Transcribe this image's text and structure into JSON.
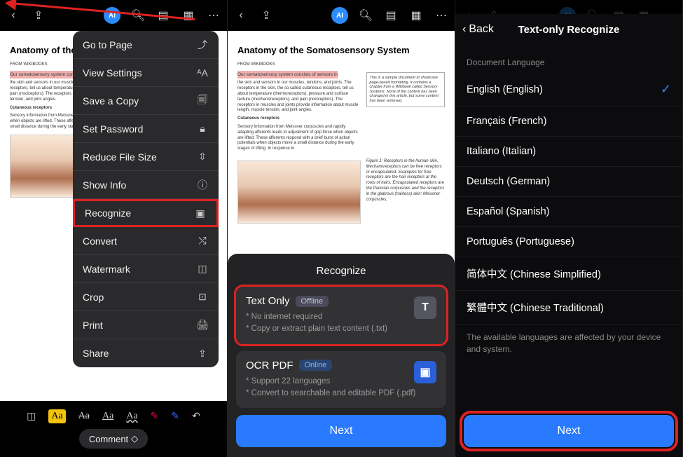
{
  "doc": {
    "title": "Anatomy of the Somatosensory System",
    "sub": "From Wikibooks",
    "hl": "Our somatosensory system consists of sensors in",
    "txt1": "the skin and sensors in our muscles, tendons, and joints. The receptors in the skin, the so called cutaneous receptors, tell us about temperature (thermoreceptors), pressure and surface texture (mechanoreceptors), and pain (nociceptors). The receptors in muscles and joints provide information about muscle length, muscle tension, and joint angles.",
    "section": "Cutaneous receptors",
    "txt2": "Sensory information from Meissner corpuscles and rapidly adapting afferents leads to adjustment of grip force when objects are lifted. These afferents respond with a brief burst of action potentials when objects move a small distance during the early stages of lifting. In response to",
    "box": "This is a sample document to showcase page-based formatting. It contains a chapter from a Wikibook called Sensory Systems. None of the content has been changed in this article, but some content has been removed.",
    "figcap": "Figure 1: Receptors in the human skin. Mechanoreceptors can be free receptors or encapsulated. Examples for free receptors are the hair receptors at the roots of hairs. Encapsulated receptors are the Pacinian corpuscles and the receptors in the glabrous (hairless) skin: Meissner corpuscles,"
  },
  "topbar_ai": "AI",
  "screen1": {
    "menu": {
      "goto": "Go to Page",
      "view": "View Settings",
      "savecopy": "Save a Copy",
      "setpwd": "Set Password",
      "reduce": "Reduce File Size",
      "showinfo": "Show Info",
      "recognize": "Recognize",
      "convert": "Convert",
      "watermark": "Watermark",
      "crop": "Crop",
      "print": "Print",
      "share": "Share"
    },
    "comment": "Comment"
  },
  "screen2": {
    "sheet_title": "Recognize",
    "opt1": {
      "title": "Text Only",
      "badge": "Offline",
      "l1": "* No internet required",
      "l2": "* Copy or extract plain text content (.txt)"
    },
    "opt2": {
      "title": "OCR PDF",
      "badge": "Online",
      "l1": "* Support 22 languages",
      "l2": "* Convert to searchable and editable PDF (.pdf)"
    },
    "next": "Next"
  },
  "screen3": {
    "back": "Back",
    "title": "Text-only Recognize",
    "section": "Document Language",
    "langs": [
      "English (English)",
      "Français (French)",
      "Italiano (Italian)",
      "Deutsch (German)",
      "Español (Spanish)",
      "Português (Portuguese)",
      "简体中文 (Chinese Simplified)",
      "繁體中文 (Chinese Traditional)"
    ],
    "note": "The available languages are affected by your device and system.",
    "next": "Next"
  }
}
